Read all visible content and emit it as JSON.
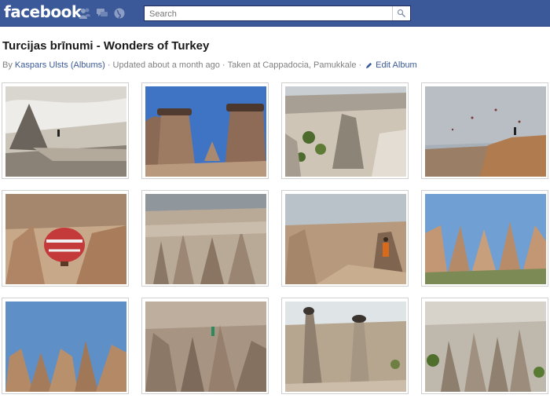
{
  "header": {
    "logo": "facebook",
    "search": {
      "placeholder": "Search"
    },
    "icons": [
      "friends-icon",
      "messages-icon",
      "notifications-globe-icon",
      "search-magnifier-icon"
    ]
  },
  "album": {
    "title": "Turcijas brīnumi - Wonders of Turkey",
    "by_label": "By",
    "author": "Kaspars Ulsts",
    "albums_link": "(Albums)",
    "sep1": "·",
    "updated": "Updated about a month ago",
    "sep2": "·",
    "location": "Taken at Cappadocia, Pamukkale",
    "sep3": "·",
    "edit_label": "Edit Album"
  },
  "photos": [
    {
      "scene": "white-cliffs-with-walker"
    },
    {
      "scene": "twin-hoodoos-blue-sky"
    },
    {
      "scene": "valley-with-green-trees"
    },
    {
      "scene": "hazy-sky-balloons-cliff"
    },
    {
      "scene": "hot-air-balloon-in-valley"
    },
    {
      "scene": "field-of-rock-spires"
    },
    {
      "scene": "hiker-on-ridge"
    },
    {
      "scene": "chimney-rocks-at-sunset"
    },
    {
      "scene": "spires-under-blue-sky"
    },
    {
      "scene": "person-climbing-rocks"
    },
    {
      "scene": "mushroom-capped-pillars"
    },
    {
      "scene": "fairy-chimneys-with-trees"
    }
  ]
}
